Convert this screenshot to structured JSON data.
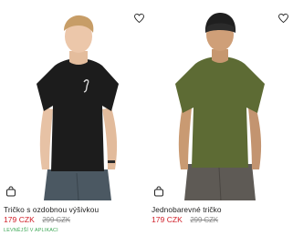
{
  "products": [
    {
      "name": "Tričko s ozdobnou výšivkou",
      "price": "179 CZK",
      "old_price": "299 CZK",
      "promo": "LEVNĚJŠÍ V APLIKACI",
      "shirt_color": "#1c1c1c",
      "photo_alt": "Model wearing black t-shirt"
    },
    {
      "name": "Jednobarevné tričko",
      "price": "179 CZK",
      "old_price": "299 CZK",
      "shirt_color": "#5d6b34",
      "photo_alt": "Model wearing olive green t-shirt"
    }
  ],
  "icons": {
    "favorite": "heart-icon",
    "cart": "shopping-bag-icon"
  },
  "colors": {
    "sale_price": "#d0202a",
    "old_price": "#8a8a8a",
    "promo": "#3aa653"
  }
}
